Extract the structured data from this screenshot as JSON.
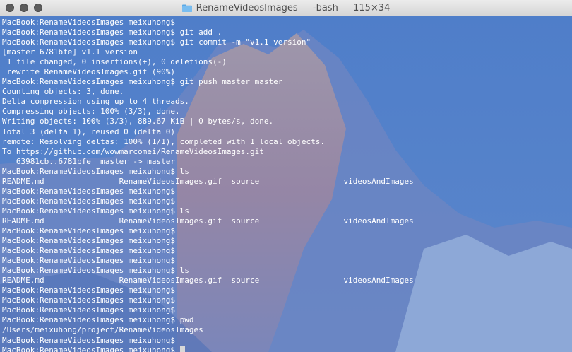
{
  "window": {
    "title": "RenameVideosImages — -bash — 115×34"
  },
  "terminal": {
    "lines": [
      "MacBook:RenameVideosImages meixuhong$",
      "MacBook:RenameVideosImages meixuhong$ git add .",
      "MacBook:RenameVideosImages meixuhong$ git commit -m \"v1.1 version\"",
      "[master 6781bfe] v1.1 version",
      " 1 file changed, 0 insertions(+), 0 deletions(-)",
      " rewrite RenameVideosImages.gif (90%)",
      "MacBook:RenameVideosImages meixuhong$ git push master master",
      "Counting objects: 3, done.",
      "Delta compression using up to 4 threads.",
      "Compressing objects: 100% (3/3), done.",
      "Writing objects: 100% (3/3), 889.67 KiB | 0 bytes/s, done.",
      "Total 3 (delta 1), reused 0 (delta 0)",
      "remote: Resolving deltas: 100% (1/1), completed with 1 local objects.",
      "To https://github.com/wowmarcomei/RenameVideosImages.git",
      "   63981cb..6781bfe  master -> master",
      "MacBook:RenameVideosImages meixuhong$ ls",
      "README.md                RenameVideosImages.gif  source                  videosAndImages",
      "MacBook:RenameVideosImages meixuhong$",
      "MacBook:RenameVideosImages meixuhong$",
      "MacBook:RenameVideosImages meixuhong$ ls",
      "README.md                RenameVideosImages.gif  source                  videosAndImages",
      "MacBook:RenameVideosImages meixuhong$",
      "MacBook:RenameVideosImages meixuhong$",
      "MacBook:RenameVideosImages meixuhong$",
      "MacBook:RenameVideosImages meixuhong$",
      "MacBook:RenameVideosImages meixuhong$ ls",
      "README.md                RenameVideosImages.gif  source                  videosAndImages",
      "MacBook:RenameVideosImages meixuhong$",
      "MacBook:RenameVideosImages meixuhong$",
      "MacBook:RenameVideosImages meixuhong$",
      "MacBook:RenameVideosImages meixuhong$ pwd",
      "/Users/meixuhong/project/RenameVideosImages",
      "MacBook:RenameVideosImages meixuhong$",
      "MacBook:RenameVideosImages meixuhong$ "
    ]
  },
  "colors": {
    "text": "#ffffff",
    "cursor": "#d8d8d8",
    "background": "#5a86cf"
  },
  "icons": {
    "title_icon": "folder-icon",
    "window_controls": [
      "close-button",
      "minimize-button",
      "zoom-button"
    ]
  }
}
